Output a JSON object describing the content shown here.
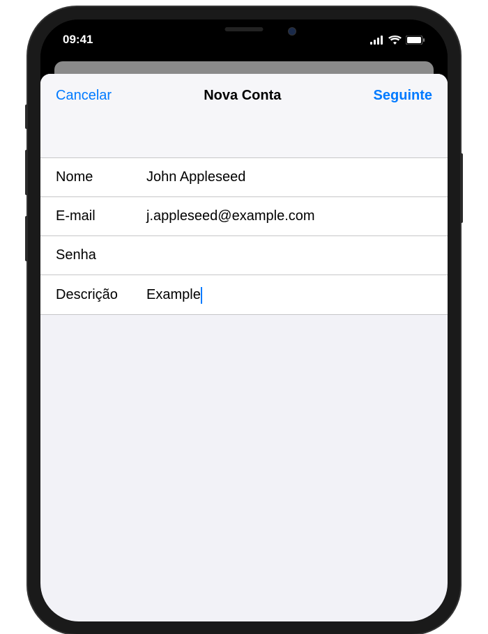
{
  "statusBar": {
    "time": "09:41"
  },
  "navBar": {
    "cancel": "Cancelar",
    "title": "Nova Conta",
    "next": "Seguinte"
  },
  "form": {
    "fields": [
      {
        "label": "Nome",
        "value": "John Appleseed"
      },
      {
        "label": "E-mail",
        "value": "j.appleseed@example.com"
      },
      {
        "label": "Senha",
        "value": ""
      },
      {
        "label": "Descrição",
        "value": "Example"
      }
    ]
  }
}
